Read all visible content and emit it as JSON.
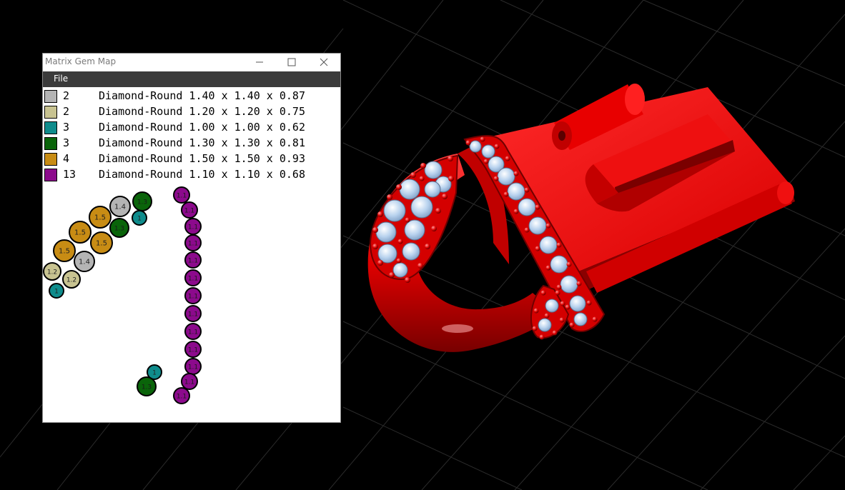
{
  "window": {
    "title": "Matrix Gem Map",
    "menu_file": "File",
    "btn_min": "—",
    "btn_max": "☐",
    "btn_close": "✕"
  },
  "legend": [
    {
      "count": "2",
      "desc": "Diamond-Round 1.40 x 1.40 x 0.87",
      "color": "#b4b4b4"
    },
    {
      "count": "2",
      "desc": "Diamond-Round 1.20 x 1.20 x 0.75",
      "color": "#c8c391"
    },
    {
      "count": "3",
      "desc": "Diamond-Round 1.00 x 1.00 x 0.62",
      "color": "#0f8c8c"
    },
    {
      "count": "3",
      "desc": "Diamond-Round 1.30 x 1.30 x 0.81",
      "color": "#0a640a"
    },
    {
      "count": "4",
      "desc": "Diamond-Round 1.50 x 1.50 x 0.93",
      "color": "#c88c14"
    },
    {
      "count": "13",
      "desc": "Diamond-Round 1.10 x 1.10 x 0.68",
      "color": "#8c0a8c"
    }
  ],
  "gem_labels": {
    "g140": "1.4",
    "g120": "1.2",
    "g100": "1",
    "g130": "1.3",
    "g150": "1.5",
    "g110": "1.1"
  }
}
